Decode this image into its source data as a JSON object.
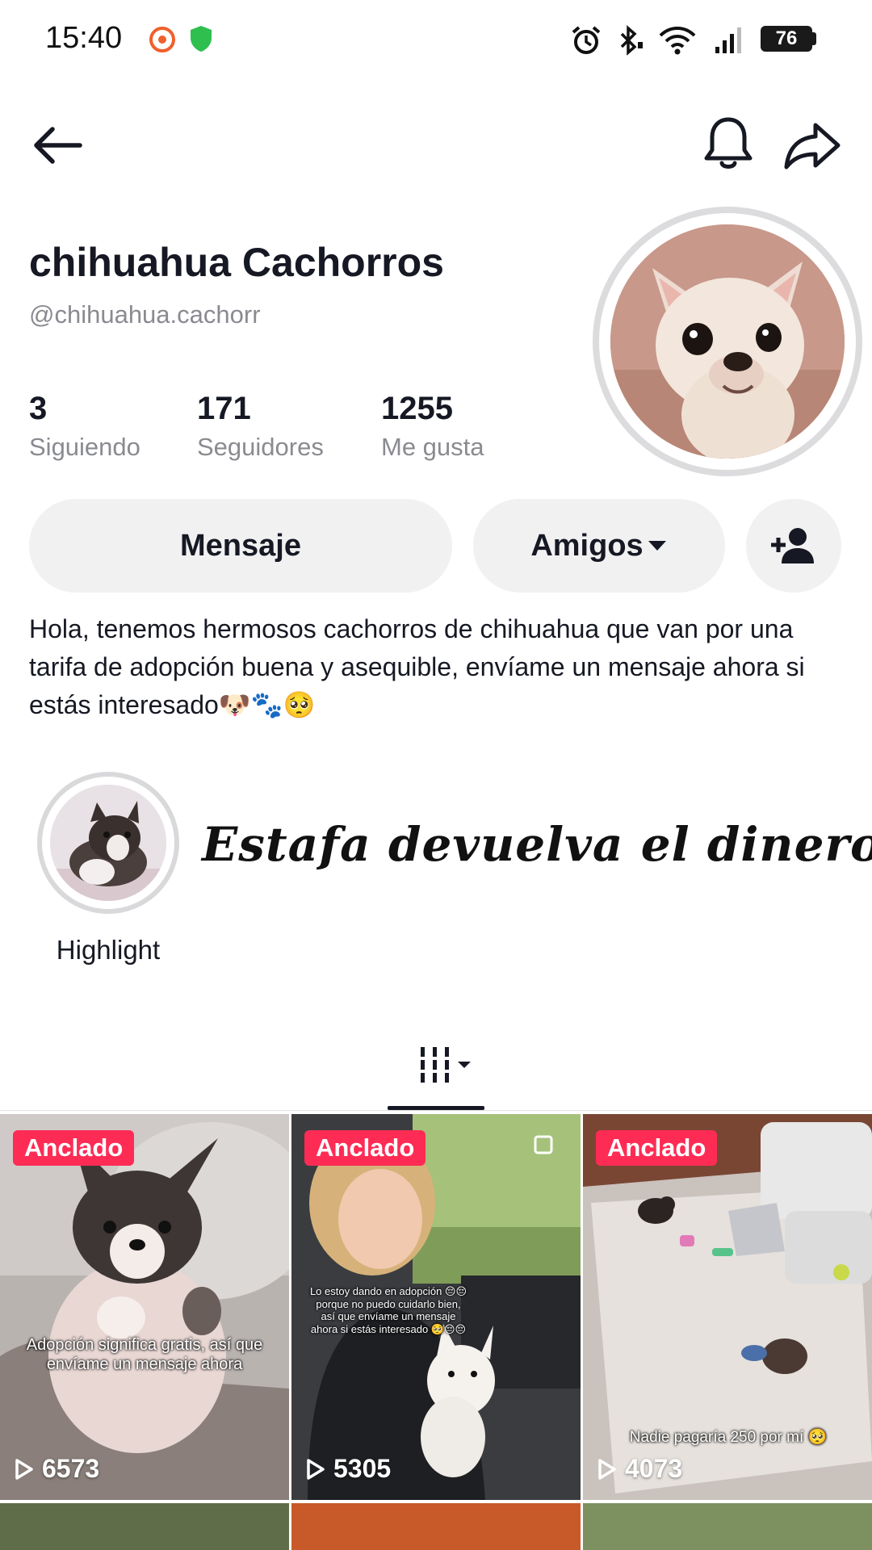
{
  "status_bar": {
    "time": "15:40",
    "battery": "76",
    "icons": [
      "notification-app-icon",
      "shield-icon",
      "alarm-icon",
      "bluetooth-icon",
      "wifi-icon",
      "signal-icon",
      "battery-icon"
    ]
  },
  "nav": {
    "icons": [
      "back-arrow-icon",
      "bell-icon",
      "share-icon"
    ]
  },
  "profile": {
    "name": "chihuahua Cachorros",
    "handle": "@chihuahua.cachorr",
    "stats": [
      {
        "value": "3",
        "label": "Siguiendo"
      },
      {
        "value": "171",
        "label": "Seguidores"
      },
      {
        "value": "1255",
        "label": "Me gusta"
      }
    ],
    "bio": "Hola, tenemos hermosos cachorros de chihuahua que van por una tarifa de adopción buena y asequible, envíame un mensaje ahora si estás interesado🐶🐾🥺"
  },
  "actions": {
    "message": "Mensaje",
    "friends": "Amigos",
    "add_friend_icon": "add-user-icon"
  },
  "highlight": {
    "label": "Highlight"
  },
  "overlay": {
    "text": "Estafa devuelva el dinero"
  },
  "tabs": {
    "icon": "grid-icon"
  },
  "videos": [
    {
      "pinned": "Anclado",
      "views": "6573",
      "caption": "Adopción significa gratis, así que envíame un mensaje ahora"
    },
    {
      "pinned": "Anclado",
      "views": "5305",
      "caption": "Lo estoy dando en adopción 😔😔 porque no puedo cuidarlo bien, así que envíame un mensaje ahora si estás interesado 🥺😔😔"
    },
    {
      "pinned": "Anclado",
      "views": "4073",
      "caption": "Nadie pagaría 250 por mí 🥺"
    }
  ],
  "colors": {
    "pin_badge": "#fe2c55",
    "button_bg": "#f1f1f2",
    "secondary_text": "#8a8b91"
  }
}
